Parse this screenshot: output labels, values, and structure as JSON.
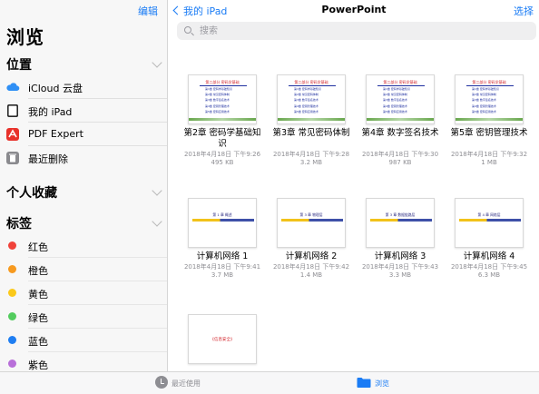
{
  "sidebar": {
    "edit_label": "编辑",
    "title": "浏览",
    "locations_header": "位置",
    "locations": [
      {
        "label": "iCloud 云盘",
        "icon": "icloud-icon"
      },
      {
        "label": "我的 iPad",
        "icon": "ipad-icon"
      },
      {
        "label": "PDF Expert",
        "icon": "pdf-expert-icon"
      },
      {
        "label": "最近删除",
        "icon": "trash-icon"
      }
    ],
    "favorites_header": "个人收藏",
    "tags_header": "标签",
    "tags": [
      {
        "label": "红色",
        "color": "#f0423a"
      },
      {
        "label": "橙色",
        "color": "#f79a1f"
      },
      {
        "label": "黄色",
        "color": "#fbc91a"
      },
      {
        "label": "绿色",
        "color": "#53cc5e"
      },
      {
        "label": "蓝色",
        "color": "#1f7ef2"
      },
      {
        "label": "紫色",
        "color": "#b86fd9"
      }
    ]
  },
  "main": {
    "back_label": "我的 iPad",
    "title": "PowerPoint",
    "select_label": "选择",
    "search_placeholder": "搜索",
    "files": [
      {
        "name": "第2章 密码学基础知识",
        "date": "2018年4月18日 下午9:26",
        "size": "495 KB",
        "thumb": "crypto"
      },
      {
        "name": "第3章 常见密码体制",
        "date": "2018年4月18日 下午9:28",
        "size": "3.2 MB",
        "thumb": "crypto"
      },
      {
        "name": "第4章 数字签名技术",
        "date": "2018年4月18日 下午9:30",
        "size": "987 KB",
        "thumb": "crypto"
      },
      {
        "name": "第5章 密钥管理技术",
        "date": "2018年4月18日 下午9:32",
        "size": "1 MB",
        "thumb": "crypto"
      },
      {
        "name": "计算机网络 1",
        "date": "2018年4月18日 下午9:41",
        "size": "3.7 MB",
        "thumb": "network",
        "slide_text": "第 1 章    概述"
      },
      {
        "name": "计算机网络 2",
        "date": "2018年4月18日 下午9:42",
        "size": "1.4 MB",
        "thumb": "network",
        "slide_text": "第 3 章  物理层"
      },
      {
        "name": "计算机网络 3",
        "date": "2018年4月18日 下午9:43",
        "size": "3.3 MB",
        "thumb": "network",
        "slide_text": "第 3 章  数据链路层"
      },
      {
        "name": "计算机网络 4",
        "date": "2018年4月18日 下午9:45",
        "size": "6.3 MB",
        "thumb": "network",
        "slide_text": "第 4 章  网络层"
      },
      {
        "name": "",
        "date": "",
        "size": "",
        "thumb": "security",
        "slide_text": "《信息安全》"
      }
    ],
    "crypto_thumb": {
      "heading": "第二部分 密码学基础",
      "lines": [
        "第1章 密码学基础知识",
        "第2章 常见密码体制",
        "第3章 数字签名技术",
        "第4章 密钥管理技术",
        "第5章 密码应用技术"
      ]
    }
  },
  "tabbar": {
    "recent_label": "最近使用",
    "browse_label": "浏览"
  },
  "colors": {
    "accent": "#1a7cf5",
    "secondary_text": "#8e8e93"
  }
}
